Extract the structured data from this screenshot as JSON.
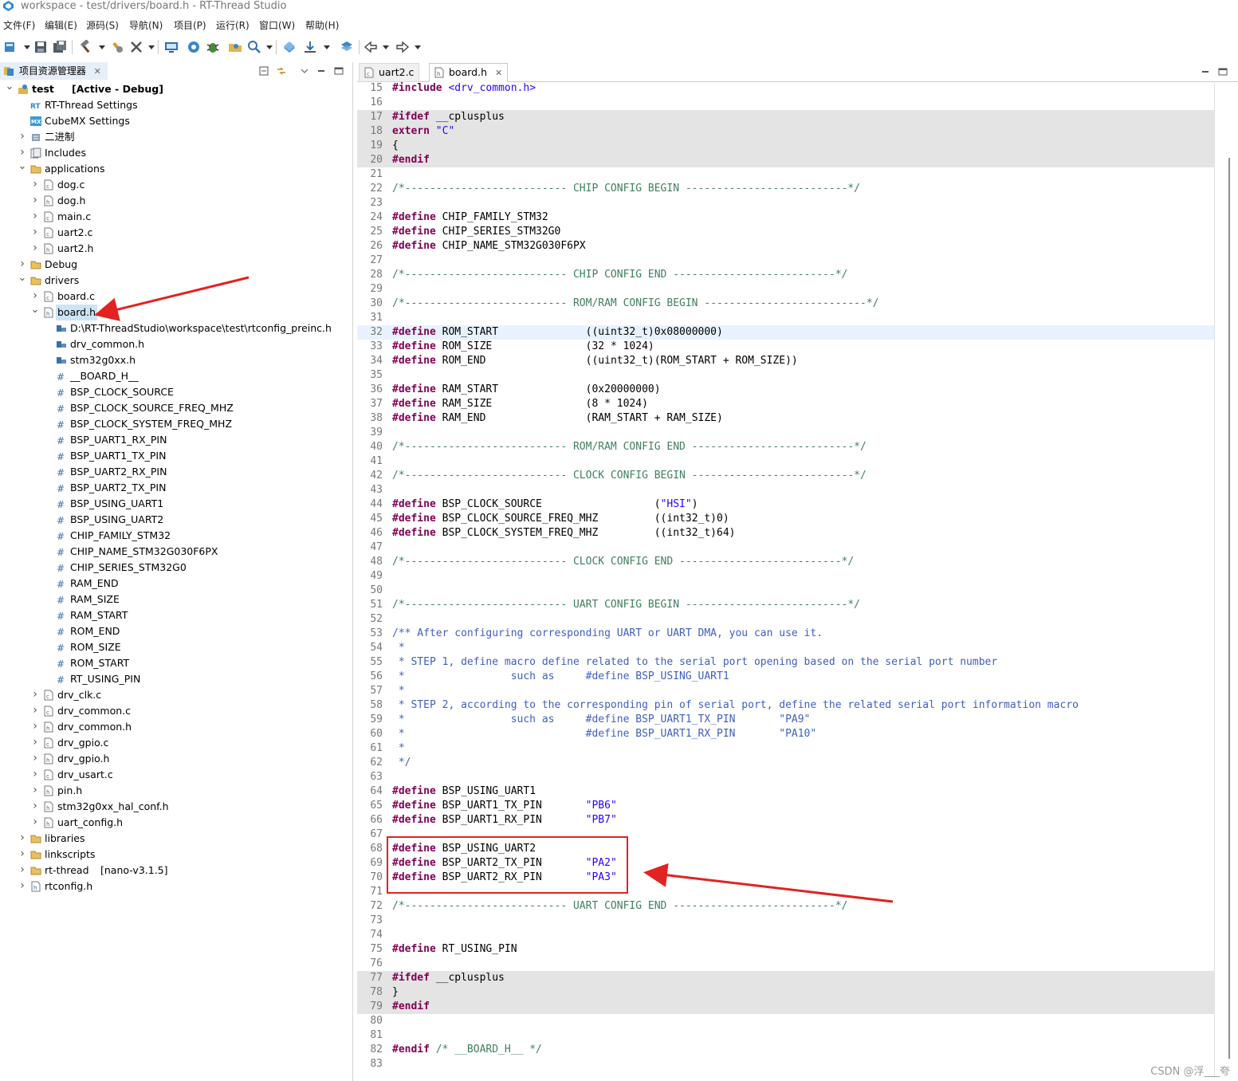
{
  "window": {
    "title": "workspace - test/drivers/board.h - RT-Thread Studio"
  },
  "menu": [
    "文件(F)",
    "编辑(E)",
    "源码(S)",
    "导航(N)",
    "项目(P)",
    "运行(R)",
    "窗口(W)",
    "帮助(H)"
  ],
  "toolbar": {
    "icons": [
      "new-icon",
      "save-icon",
      "save-all-icon",
      "build-icon",
      "clean-icon",
      "tools-icon",
      "download-icon",
      "settings-icon",
      "debug-icon",
      "open-folder-icon",
      "search-icon",
      "sdk-icon",
      "download-arrow-icon",
      "layers-icon",
      "back-icon",
      "forward-icon"
    ]
  },
  "explorer": {
    "title": "项目资源管理器",
    "tree": [
      {
        "label": "test",
        "decoration": "[Active - Debug]",
        "icon": "project-icon",
        "expanded": true
      },
      {
        "label": "RT-Thread Settings",
        "icon": "rt-settings-icon"
      },
      {
        "label": "CubeMX Settings",
        "icon": "cubemx-icon"
      },
      {
        "label": "二进制",
        "icon": "binary-icon"
      },
      {
        "label": "Includes",
        "icon": "includes-icon"
      },
      {
        "label": "applications",
        "icon": "folder-icon",
        "expanded": true
      },
      {
        "label": "dog.c",
        "icon": "c-file-icon"
      },
      {
        "label": "dog.h",
        "icon": "h-file-icon"
      },
      {
        "label": "main.c",
        "icon": "c-file-icon"
      },
      {
        "label": "uart2.c",
        "icon": "c-file-icon"
      },
      {
        "label": "uart2.h",
        "icon": "h-file-icon"
      },
      {
        "label": "Debug",
        "icon": "folder-icon"
      },
      {
        "label": "drivers",
        "icon": "folder-icon",
        "expanded": true
      },
      {
        "label": "board.c",
        "icon": "c-file-icon"
      },
      {
        "label": "board.h",
        "icon": "h-file-icon",
        "expanded": true,
        "selected": true
      },
      {
        "label": "D:\\RT-ThreadStudio\\workspace\\test\\rtconfig_preinc.h",
        "icon": "include-icon"
      },
      {
        "label": "drv_common.h",
        "icon": "include-icon"
      },
      {
        "label": "stm32g0xx.h",
        "icon": "include-icon"
      },
      {
        "label": "__BOARD_H__",
        "icon": "macro-icon"
      },
      {
        "label": "BSP_CLOCK_SOURCE",
        "icon": "macro-icon"
      },
      {
        "label": "BSP_CLOCK_SOURCE_FREQ_MHZ",
        "icon": "macro-icon"
      },
      {
        "label": "BSP_CLOCK_SYSTEM_FREQ_MHZ",
        "icon": "macro-icon"
      },
      {
        "label": "BSP_UART1_RX_PIN",
        "icon": "macro-icon"
      },
      {
        "label": "BSP_UART1_TX_PIN",
        "icon": "macro-icon"
      },
      {
        "label": "BSP_UART2_RX_PIN",
        "icon": "macro-icon"
      },
      {
        "label": "BSP_UART2_TX_PIN",
        "icon": "macro-icon"
      },
      {
        "label": "BSP_USING_UART1",
        "icon": "macro-icon"
      },
      {
        "label": "BSP_USING_UART2",
        "icon": "macro-icon"
      },
      {
        "label": "CHIP_FAMILY_STM32",
        "icon": "macro-icon"
      },
      {
        "label": "CHIP_NAME_STM32G030F6PX",
        "icon": "macro-icon"
      },
      {
        "label": "CHIP_SERIES_STM32G0",
        "icon": "macro-icon"
      },
      {
        "label": "RAM_END",
        "icon": "macro-icon"
      },
      {
        "label": "RAM_SIZE",
        "icon": "macro-icon"
      },
      {
        "label": "RAM_START",
        "icon": "macro-icon"
      },
      {
        "label": "ROM_END",
        "icon": "macro-icon"
      },
      {
        "label": "ROM_SIZE",
        "icon": "macro-icon"
      },
      {
        "label": "ROM_START",
        "icon": "macro-icon"
      },
      {
        "label": "RT_USING_PIN",
        "icon": "macro-icon"
      },
      {
        "label": "drv_clk.c",
        "icon": "c-file-icon"
      },
      {
        "label": "drv_common.c",
        "icon": "c-file-icon"
      },
      {
        "label": "drv_common.h",
        "icon": "h-file-icon"
      },
      {
        "label": "drv_gpio.c",
        "icon": "c-file-icon"
      },
      {
        "label": "drv_gpio.h",
        "icon": "h-file-icon"
      },
      {
        "label": "drv_usart.c",
        "icon": "c-file-icon"
      },
      {
        "label": "pin.h",
        "icon": "h-file-icon"
      },
      {
        "label": "stm32g0xx_hal_conf.h",
        "icon": "h-file-icon"
      },
      {
        "label": "uart_config.h",
        "icon": "h-file-icon"
      },
      {
        "label": "libraries",
        "icon": "folder-icon"
      },
      {
        "label": "linkscripts",
        "icon": "folder-icon"
      },
      {
        "label": "rt-thread",
        "decoration": "[nano-v3.1.5]",
        "icon": "folder-icon"
      },
      {
        "label": "rtconfig.h",
        "icon": "h-file-icon"
      }
    ]
  },
  "editor": {
    "tabs": [
      {
        "label": "uart2.c",
        "active": false
      },
      {
        "label": "board.h",
        "active": true
      }
    ],
    "lines": [
      {
        "n": "15",
        "t": "#include <drv_common.h>"
      },
      {
        "n": "16",
        "t": ""
      },
      {
        "n": "17",
        "t": "#ifdef __cplusplus"
      },
      {
        "n": "18",
        "t": "extern \"C\""
      },
      {
        "n": "19",
        "t": "{"
      },
      {
        "n": "20",
        "t": "#endif"
      },
      {
        "n": "21",
        "t": ""
      },
      {
        "n": "22",
        "t": "/*-------------------------- CHIP CONFIG BEGIN --------------------------*/"
      },
      {
        "n": "23",
        "t": ""
      },
      {
        "n": "24",
        "t": "#define CHIP_FAMILY_STM32"
      },
      {
        "n": "25",
        "t": "#define CHIP_SERIES_STM32G0"
      },
      {
        "n": "26",
        "t": "#define CHIP_NAME_STM32G030F6PX"
      },
      {
        "n": "27",
        "t": ""
      },
      {
        "n": "28",
        "t": "/*-------------------------- CHIP CONFIG END --------------------------*/"
      },
      {
        "n": "29",
        "t": ""
      },
      {
        "n": "30",
        "t": "/*-------------------------- ROM/RAM CONFIG BEGIN --------------------------*/"
      },
      {
        "n": "31",
        "t": ""
      },
      {
        "n": "32",
        "t": "#define ROM_START              ((uint32_t)0x08000000)"
      },
      {
        "n": "33",
        "t": "#define ROM_SIZE               (32 * 1024)"
      },
      {
        "n": "34",
        "t": "#define ROM_END                ((uint32_t)(ROM_START + ROM_SIZE))"
      },
      {
        "n": "35",
        "t": ""
      },
      {
        "n": "36",
        "t": "#define RAM_START              (0x20000000)"
      },
      {
        "n": "37",
        "t": "#define RAM_SIZE               (8 * 1024)"
      },
      {
        "n": "38",
        "t": "#define RAM_END                (RAM_START + RAM_SIZE)"
      },
      {
        "n": "39",
        "t": ""
      },
      {
        "n": "40",
        "t": "/*-------------------------- ROM/RAM CONFIG END --------------------------*/"
      },
      {
        "n": "41",
        "t": ""
      },
      {
        "n": "42",
        "t": "/*-------------------------- CLOCK CONFIG BEGIN --------------------------*/"
      },
      {
        "n": "43",
        "t": ""
      },
      {
        "n": "44",
        "t": "#define BSP_CLOCK_SOURCE                  (\"HSI\")"
      },
      {
        "n": "45",
        "t": "#define BSP_CLOCK_SOURCE_FREQ_MHZ         ((int32_t)0)"
      },
      {
        "n": "46",
        "t": "#define BSP_CLOCK_SYSTEM_FREQ_MHZ         ((int32_t)64)"
      },
      {
        "n": "47",
        "t": ""
      },
      {
        "n": "48",
        "t": "/*-------------------------- CLOCK CONFIG END --------------------------*/"
      },
      {
        "n": "49",
        "t": ""
      },
      {
        "n": "50",
        "t": ""
      },
      {
        "n": "51",
        "t": "/*-------------------------- UART CONFIG BEGIN --------------------------*/"
      },
      {
        "n": "52",
        "t": ""
      },
      {
        "n": "53",
        "t": "/** After configuring corresponding UART or UART DMA, you can use it."
      },
      {
        "n": "54",
        "t": " *"
      },
      {
        "n": "55",
        "t": " * STEP 1, define macro define related to the serial port opening based on the serial port number"
      },
      {
        "n": "56",
        "t": " *                 such as     #define BSP_USING_UART1"
      },
      {
        "n": "57",
        "t": " *"
      },
      {
        "n": "58",
        "t": " * STEP 2, according to the corresponding pin of serial port, define the related serial port information macro"
      },
      {
        "n": "59",
        "t": " *                 such as     #define BSP_UART1_TX_PIN       \"PA9\""
      },
      {
        "n": "60",
        "t": " *                             #define BSP_UART1_RX_PIN       \"PA10\""
      },
      {
        "n": "61",
        "t": " *"
      },
      {
        "n": "62",
        "t": " */"
      },
      {
        "n": "63",
        "t": ""
      },
      {
        "n": "64",
        "t": "#define BSP_USING_UART1"
      },
      {
        "n": "65",
        "t": "#define BSP_UART1_TX_PIN       \"PB6\""
      },
      {
        "n": "66",
        "t": "#define BSP_UART1_RX_PIN       \"PB7\""
      },
      {
        "n": "67",
        "t": ""
      },
      {
        "n": "68",
        "t": "#define BSP_USING_UART2"
      },
      {
        "n": "69",
        "t": "#define BSP_UART2_TX_PIN       \"PA2\""
      },
      {
        "n": "70",
        "t": "#define BSP_UART2_RX_PIN       \"PA3\""
      },
      {
        "n": "71",
        "t": ""
      },
      {
        "n": "72",
        "t": "/*-------------------------- UART CONFIG END --------------------------*/"
      },
      {
        "n": "73",
        "t": ""
      },
      {
        "n": "74",
        "t": ""
      },
      {
        "n": "75",
        "t": "#define RT_USING_PIN"
      },
      {
        "n": "76",
        "t": ""
      },
      {
        "n": "77",
        "t": "#ifdef __cplusplus"
      },
      {
        "n": "78",
        "t": "}"
      },
      {
        "n": "79",
        "t": "#endif"
      },
      {
        "n": "80",
        "t": ""
      },
      {
        "n": "81",
        "t": ""
      },
      {
        "n": "82",
        "t": "#endif /* __BOARD_H__ */"
      },
      {
        "n": "83",
        "t": ""
      }
    ]
  },
  "watermark": "CSDN @浮___夸",
  "colors": {
    "keyword": "#7f0055",
    "string": "#2a00ff",
    "comment": "#3f7f5f",
    "doc": "#3f5fbf",
    "annotation": "#e32222",
    "preproc_bg": "#e4e4e4"
  }
}
